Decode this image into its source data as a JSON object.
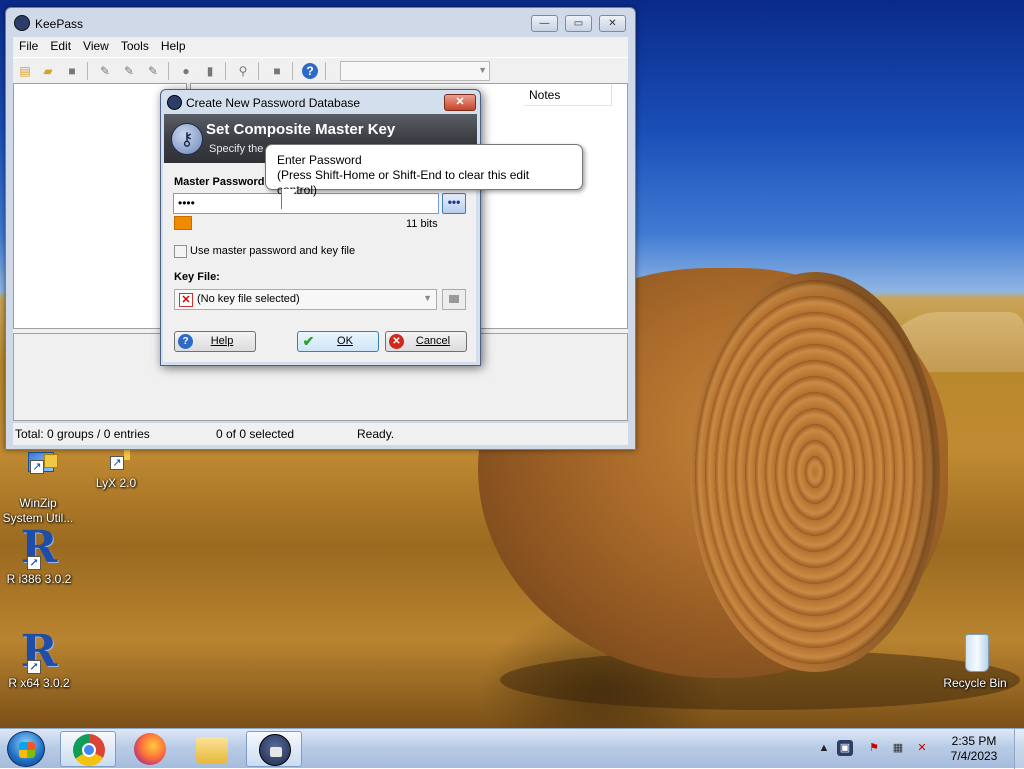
{
  "main_window": {
    "title": "KeePass",
    "menu": [
      "File",
      "Edit",
      "View",
      "Tools",
      "Help"
    ],
    "columns": [
      "Notes"
    ],
    "status": {
      "totals": "Total: 0 groups / 0 entries",
      "selection": "0 of 0 selected",
      "state": "Ready."
    }
  },
  "dialog": {
    "title": "Create New Password Database",
    "banner_title": "Set Composite Master Key",
    "banner_subtitle": "Specify the",
    "master_password_label": "Master Password:",
    "password_value": "••••",
    "quality_text": "11 bits",
    "checkbox_label": "Use master password and key file",
    "key_file_label": "Key File:",
    "key_file_value": "(No key file selected)",
    "help_button": "Help",
    "ok_button": "OK",
    "cancel_button": "Cancel",
    "close_glyph": "✕",
    "show_password_glyph": "•••"
  },
  "tooltip": {
    "line1": "Enter Password",
    "line2": "(Press Shift-Home or Shift-End to clear this edit control)"
  },
  "desktop_icons": [
    {
      "label_line1": "WinZip",
      "label_line2": "System Util..."
    },
    {
      "label_line1": "LyX 2.0",
      "label_line2": ""
    },
    {
      "label_line1": "R i386 3.0.2",
      "label_line2": ""
    },
    {
      "label_line1": "R x64 3.0.2",
      "label_line2": ""
    },
    {
      "label_line1": "Recycle Bin",
      "label_line2": ""
    }
  ],
  "taskbar": {
    "apps": [
      "chrome-icon",
      "firefox-icon",
      "file-explorer-icon",
      "keepass-icon"
    ],
    "time": "2:35 PM",
    "date": "7/4/2023"
  },
  "colors": {
    "quality_bar": "#f08a00",
    "window_frame": "#cfd9e8",
    "dialog_banner": "#3c3e44"
  }
}
